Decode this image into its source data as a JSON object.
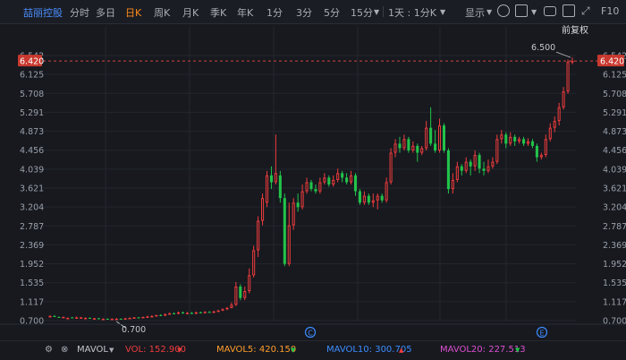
{
  "toolbar": {
    "stock_name": "喆丽控股",
    "periods": [
      "分时",
      "多日",
      "日K",
      "周K",
      "月K",
      "季K",
      "年K",
      "1分",
      "3分",
      "5分",
      "15分"
    ],
    "active_period": "日K",
    "multi_period": "1天 : 1分K",
    "display_label": "显示",
    "f10_label": "F10"
  },
  "adjust_label": "前复权",
  "price_tag": "6.420",
  "max_label": "6.500",
  "min_label": "0.700",
  "markers": [
    "C",
    "E"
  ],
  "colors": {
    "up": "#ef3c3c",
    "down": "#22c34a",
    "accent": "#ff8c1a",
    "background": "#17191f",
    "mavol5": "#ff9d2a",
    "mavol10": "#3d8cff",
    "mavol20": "#dd4fd0"
  },
  "volume_bar": {
    "label": "MAVOL",
    "vol": "VOL: 152.900",
    "mavol5": "MAVOL5: 420.150",
    "mavol10": "MAVOL10: 300.705",
    "mavol20": "MAVOL20: 227.513"
  },
  "chart_data": {
    "type": "candlestick",
    "ytick_labels": [
      "6.542",
      "6.125",
      "5.708",
      "5.291",
      "4.873",
      "4.456",
      "4.039",
      "3.621",
      "3.204",
      "2.787",
      "2.369",
      "1.952",
      "1.535",
      "1.117",
      "0.700"
    ],
    "ylim": [
      0.7,
      6.542
    ],
    "grid": true,
    "last_price": 6.42,
    "high": 6.5,
    "low": 0.7,
    "candles": [
      [
        0.78,
        0.8,
        0.77,
        0.82
      ],
      [
        0.8,
        0.79,
        0.78,
        0.82
      ],
      [
        0.78,
        0.77,
        0.76,
        0.79
      ],
      [
        0.77,
        0.78,
        0.76,
        0.79
      ],
      [
        0.76,
        0.76,
        0.75,
        0.77
      ],
      [
        0.77,
        0.76,
        0.75,
        0.78
      ],
      [
        0.77,
        0.77,
        0.76,
        0.79
      ],
      [
        0.76,
        0.77,
        0.75,
        0.78
      ],
      [
        0.75,
        0.76,
        0.74,
        0.77
      ],
      [
        0.76,
        0.75,
        0.74,
        0.77
      ],
      [
        0.74,
        0.75,
        0.73,
        0.76
      ],
      [
        0.75,
        0.74,
        0.73,
        0.76
      ],
      [
        0.73,
        0.74,
        0.72,
        0.75
      ],
      [
        0.74,
        0.73,
        0.72,
        0.75
      ],
      [
        0.72,
        0.74,
        0.71,
        0.75
      ],
      [
        0.73,
        0.74,
        0.72,
        0.76
      ],
      [
        0.74,
        0.73,
        0.72,
        0.75
      ],
      [
        0.73,
        0.75,
        0.72,
        0.76
      ],
      [
        0.75,
        0.76,
        0.74,
        0.77
      ],
      [
        0.76,
        0.77,
        0.75,
        0.78
      ],
      [
        0.77,
        0.76,
        0.75,
        0.78
      ],
      [
        0.76,
        0.78,
        0.75,
        0.79
      ],
      [
        0.78,
        0.79,
        0.77,
        0.81
      ],
      [
        0.79,
        0.8,
        0.78,
        0.82
      ],
      [
        0.8,
        0.82,
        0.79,
        0.83
      ],
      [
        0.82,
        0.81,
        0.8,
        0.84
      ],
      [
        0.81,
        0.84,
        0.8,
        0.86
      ],
      [
        0.84,
        0.86,
        0.83,
        0.88
      ],
      [
        0.86,
        0.85,
        0.84,
        0.88
      ],
      [
        0.85,
        0.88,
        0.84,
        0.9
      ],
      [
        0.88,
        0.86,
        0.85,
        0.9
      ],
      [
        0.86,
        0.87,
        0.85,
        0.89
      ],
      [
        0.87,
        0.85,
        0.84,
        0.89
      ],
      [
        0.85,
        0.88,
        0.84,
        0.9
      ],
      [
        0.88,
        0.87,
        0.86,
        0.9
      ],
      [
        0.87,
        0.89,
        0.86,
        0.91
      ],
      [
        0.89,
        0.88,
        0.87,
        0.91
      ],
      [
        0.88,
        0.9,
        0.87,
        0.92
      ],
      [
        0.9,
        0.92,
        0.89,
        0.94
      ],
      [
        0.92,
        0.95,
        0.91,
        0.97
      ],
      [
        0.95,
        0.98,
        0.93,
        1.0
      ],
      [
        0.98,
        1.05,
        0.97,
        1.1
      ],
      [
        1.05,
        1.45,
        1.02,
        1.55
      ],
      [
        1.45,
        1.2,
        1.15,
        1.5
      ],
      [
        1.2,
        1.35,
        1.15,
        1.45
      ],
      [
        1.35,
        1.7,
        1.3,
        1.85
      ],
      [
        1.7,
        2.25,
        1.65,
        2.35
      ],
      [
        2.25,
        2.9,
        2.1,
        3.0
      ],
      [
        2.9,
        3.4,
        2.8,
        3.5
      ],
      [
        3.3,
        3.9,
        3.2,
        4.0
      ],
      [
        3.9,
        3.75,
        3.6,
        4.1
      ],
      [
        3.75,
        3.95,
        3.7,
        4.8
      ],
      [
        3.9,
        3.4,
        3.3,
        4.0
      ],
      [
        3.4,
        1.95,
        1.9,
        3.5
      ],
      [
        1.95,
        2.8,
        1.9,
        3.3
      ],
      [
        2.8,
        3.3,
        2.7,
        3.4
      ],
      [
        3.3,
        3.2,
        3.1,
        3.5
      ],
      [
        3.2,
        3.55,
        3.15,
        3.7
      ],
      [
        3.55,
        3.75,
        3.5,
        3.85
      ],
      [
        3.75,
        3.6,
        3.55,
        3.8
      ],
      [
        3.6,
        3.55,
        3.5,
        3.7
      ],
      [
        3.55,
        3.75,
        3.5,
        3.85
      ],
      [
        3.75,
        3.85,
        3.7,
        3.95
      ],
      [
        3.85,
        3.7,
        3.65,
        3.9
      ],
      [
        3.7,
        3.8,
        3.65,
        3.9
      ],
      [
        3.8,
        3.95,
        3.75,
        4.05
      ],
      [
        3.95,
        3.85,
        3.75,
        4.0
      ],
      [
        3.85,
        3.75,
        3.7,
        3.95
      ],
      [
        3.75,
        3.9,
        3.7,
        4.0
      ],
      [
        3.9,
        3.55,
        3.45,
        3.95
      ],
      [
        3.55,
        3.3,
        3.25,
        3.6
      ],
      [
        3.3,
        3.45,
        3.25,
        3.55
      ],
      [
        3.45,
        3.3,
        3.25,
        3.5
      ],
      [
        3.3,
        3.35,
        3.2,
        3.5
      ],
      [
        3.35,
        3.45,
        3.15,
        3.5
      ],
      [
        3.45,
        3.35,
        3.3,
        3.5
      ],
      [
        3.35,
        3.75,
        3.3,
        3.85
      ],
      [
        3.75,
        4.4,
        3.7,
        4.5
      ],
      [
        4.4,
        4.6,
        4.3,
        4.7
      ],
      [
        4.6,
        4.5,
        4.4,
        4.75
      ],
      [
        4.5,
        4.7,
        4.45,
        4.8
      ],
      [
        4.7,
        4.45,
        4.4,
        4.75
      ],
      [
        4.45,
        4.55,
        4.4,
        4.65
      ],
      [
        4.55,
        4.4,
        4.2,
        4.6
      ],
      [
        4.4,
        4.5,
        4.35,
        4.55
      ],
      [
        4.5,
        4.95,
        4.45,
        5.1
      ],
      [
        4.95,
        4.6,
        4.55,
        5.4
      ],
      [
        4.6,
        4.45,
        4.4,
        4.9
      ],
      [
        4.45,
        5.0,
        4.4,
        5.15
      ],
      [
        5.0,
        4.45,
        4.4,
        5.05
      ],
      [
        4.45,
        3.6,
        3.5,
        4.5
      ],
      [
        3.6,
        3.8,
        3.5,
        3.95
      ],
      [
        3.8,
        4.1,
        3.75,
        4.2
      ],
      [
        4.1,
        4.0,
        3.9,
        4.15
      ],
      [
        4.0,
        4.2,
        3.95,
        4.3
      ],
      [
        4.2,
        4.1,
        3.9,
        4.25
      ],
      [
        4.1,
        4.35,
        4.0,
        4.45
      ],
      [
        4.35,
        4.05,
        3.95,
        4.4
      ],
      [
        4.05,
        4.0,
        3.9,
        4.2
      ],
      [
        4.0,
        4.1,
        3.95,
        4.25
      ],
      [
        4.1,
        4.2,
        4.05,
        4.3
      ],
      [
        4.2,
        4.7,
        4.15,
        4.8
      ],
      [
        4.7,
        4.8,
        4.6,
        4.9
      ],
      [
        4.8,
        4.6,
        4.5,
        4.85
      ],
      [
        4.6,
        4.75,
        4.55,
        4.85
      ],
      [
        4.75,
        4.65,
        4.55,
        4.8
      ],
      [
        4.65,
        4.7,
        4.6,
        4.75
      ],
      [
        4.7,
        4.6,
        4.55,
        4.75
      ],
      [
        4.6,
        4.65,
        4.55,
        4.72
      ],
      [
        4.65,
        4.55,
        4.5,
        4.7
      ],
      [
        4.55,
        4.3,
        4.2,
        4.6
      ],
      [
        4.3,
        4.35,
        4.25,
        4.4
      ],
      [
        4.35,
        4.7,
        4.3,
        4.8
      ],
      [
        4.7,
        4.95,
        4.65,
        5.05
      ],
      [
        4.95,
        5.1,
        4.85,
        5.2
      ],
      [
        5.1,
        5.4,
        5.0,
        5.5
      ],
      [
        5.4,
        5.75,
        5.35,
        5.85
      ],
      [
        5.75,
        6.4,
        5.7,
        6.45
      ],
      [
        6.4,
        6.42,
        6.35,
        6.5
      ]
    ]
  }
}
